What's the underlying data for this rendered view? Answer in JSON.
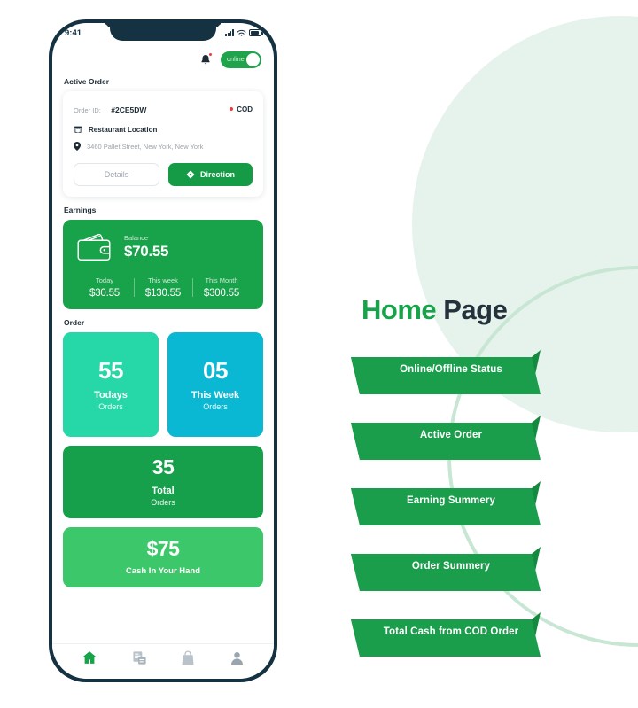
{
  "phone": {
    "status_bar": {
      "time": "9:41",
      "signal_icon": "signal-bars-icon",
      "wifi_icon": "wifi-icon",
      "battery_icon": "battery-icon"
    },
    "header": {
      "bell_icon": "notification-bell-icon",
      "toggle": {
        "label": "online",
        "state": "on"
      }
    },
    "active_order": {
      "section_title": "Active Order",
      "order_id_label": "Order ID:",
      "order_id_value": "#2CE5DW",
      "payment_badge": "COD",
      "restaurant_icon": "store-icon",
      "restaurant_label": "Restaurant Location",
      "location_icon": "map-pin-icon",
      "address": "3460  Pallet Street, New York, New York",
      "details_button": "Details",
      "direction_button": "Direction",
      "direction_icon": "navigation-diamond-icon"
    },
    "earnings": {
      "section_title": "Earnings",
      "wallet_icon": "wallet-icon",
      "balance_label": "Balance",
      "balance_value": "$70.55",
      "breakdown": [
        {
          "label": "Today",
          "value": "$30.55"
        },
        {
          "label": "This week",
          "value": "$130.55"
        },
        {
          "label": "This Month",
          "value": "$300.55"
        }
      ]
    },
    "orders": {
      "section_title": "Order",
      "cards": [
        {
          "number": "55",
          "line1": "Todays",
          "line2": "Orders",
          "color": "#26d7a8"
        },
        {
          "number": "05",
          "line1": "This Week",
          "line2": "Orders",
          "color": "#0bb8d4"
        },
        {
          "number": "35",
          "line1": "Total",
          "line2": "Orders",
          "color": "#16a04c"
        }
      ],
      "cash_card": {
        "number": "$75",
        "label": "Cash In Your Hand",
        "color": "#3cc76a"
      }
    },
    "bottom_nav": [
      {
        "icon": "home-icon",
        "active": true
      },
      {
        "icon": "invoice-icon",
        "active": false
      },
      {
        "icon": "bag-icon",
        "active": false
      },
      {
        "icon": "profile-icon",
        "active": false
      }
    ]
  },
  "annotation": {
    "title_part1": "Home ",
    "title_part2": "Page",
    "ribbons": [
      {
        "label": "Online/Offline Status"
      },
      {
        "label": "Active Order"
      },
      {
        "label": "Earning Summery"
      },
      {
        "label": "Order Summery"
      },
      {
        "label": "Total Cash from COD Order"
      }
    ]
  },
  "colors": {
    "brand_green": "#16a34a",
    "dark_navy": "#153242",
    "ribbon_green": "#1a9e4b",
    "ribbon_tail": "#148a3f",
    "teal": "#26d7a8",
    "cyan": "#0bb8d4",
    "red": "#ef3b3b"
  }
}
